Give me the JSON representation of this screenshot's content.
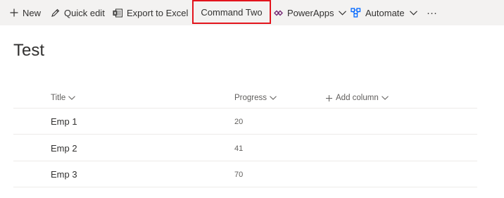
{
  "toolbar": {
    "new_label": "New",
    "quick_edit_label": "Quick edit",
    "export_label": "Export to Excel",
    "command_two_label": "Command Two",
    "powerapps_label": "PowerApps",
    "automate_label": "Automate",
    "more_label": "···"
  },
  "page": {
    "title": "Test"
  },
  "table": {
    "columns": {
      "title": "Title",
      "progress": "Progress",
      "add_column": "Add column"
    },
    "rows": [
      {
        "title": "Emp 1",
        "progress": "20"
      },
      {
        "title": "Emp 2",
        "progress": "41"
      },
      {
        "title": "Emp 3",
        "progress": "70"
      }
    ]
  },
  "colors": {
    "toolbar_bg": "#f3f2f1",
    "highlight_border": "#e3141d",
    "text": "#323130",
    "muted_text": "#605e5c",
    "powerapps_icon": "#742774",
    "automate_icon": "#0066ff"
  }
}
